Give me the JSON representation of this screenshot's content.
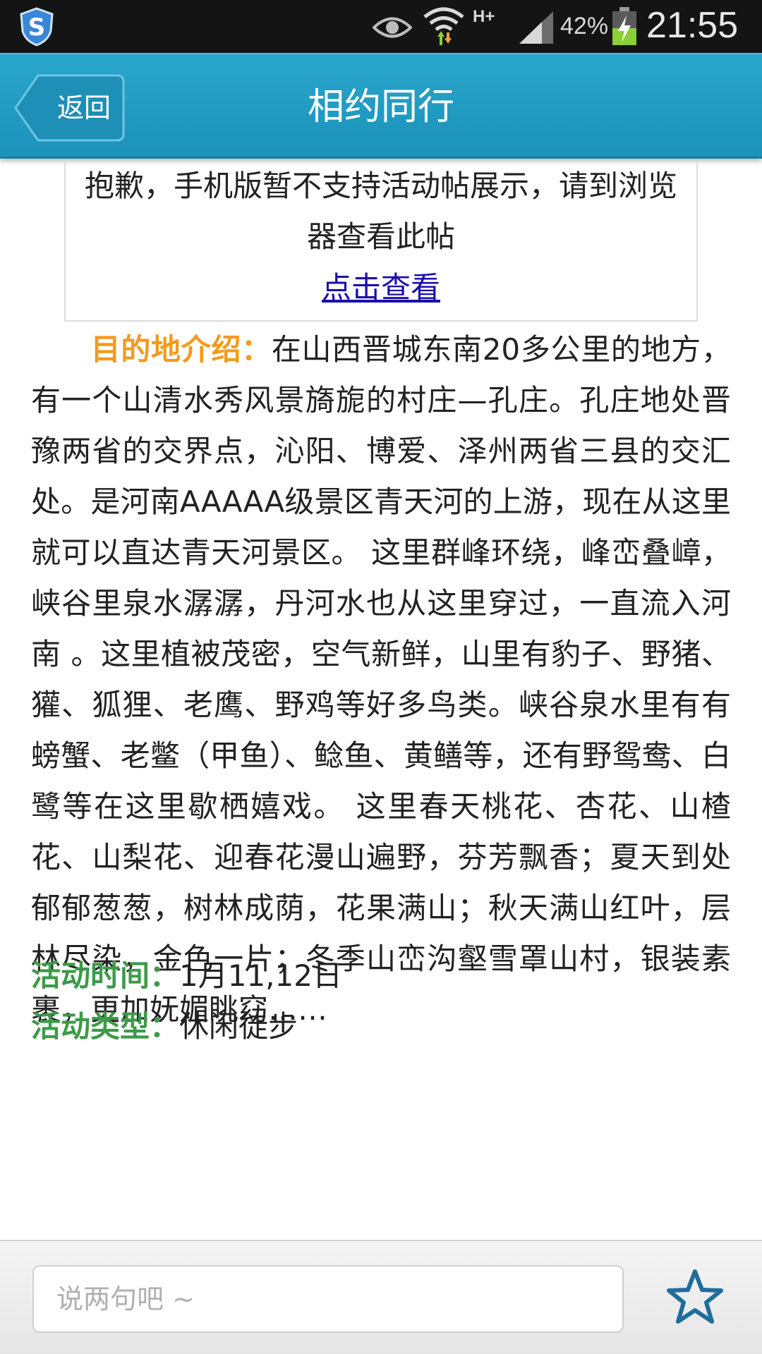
{
  "status_bar": {
    "network_type": "H+",
    "battery_percent": "42%",
    "time": "21:55",
    "icons": [
      "app-shield-icon",
      "eye-icon",
      "wifi-icon",
      "signal-icon",
      "battery-charging-icon"
    ]
  },
  "header": {
    "back_label": "返回",
    "title": "相约同行",
    "bg_color": "#1f9bc3"
  },
  "notice": {
    "text": "抱歉，手机版暂不支持活动帖展示，请到浏览器查看此帖",
    "link_text": "点击查看"
  },
  "article": {
    "intro_label": "目的地介绍：",
    "intro_label_color": "#f39b1c",
    "body": "在山西晋城东南20多公里的地方，有一个山清水秀风景旖旎的村庄—孔庄。孔庄地处晋豫两省的交界点，沁阳、博爱、泽州两省三县的交汇处。是河南AAAAA级景区青天河的上游，现在从这里就可以直达青天河景区。 这里群峰环绕，峰峦叠嶂，峡谷里泉水潺潺，丹河水也从这里穿过，一直流入河南 。这里植被茂密，空气新鲜，山里有豹子、野猪、獾、狐狸、老鹰、野鸡等好多鸟类。峡谷泉水里有有螃蟹、老鳖（甲鱼）、鲶鱼、黄鳝等，还有野鸳鸯、白鹭等在这里歇栖嬉戏。 这里春天桃花、杏花、山楂花、山梨花、迎春花漫山遍野，芬芳飘香；夏天到处郁郁葱葱，树林成荫，花果满山；秋天满山红叶，层林尽染，金色一片；冬季山峦沟壑雪罩山村，银装素裹，更加妩媚眺窈……"
  },
  "activity": {
    "time_label": "活动时间：",
    "time_value": "1月11,12日",
    "type_label": "活动类型：",
    "type_value": "休闲徒步",
    "label_color": "#3d9a48"
  },
  "comment_bar": {
    "placeholder": "说两句吧 ~",
    "favorite_icon": "star-outline-icon",
    "accent_color": "#1f6d9a"
  }
}
